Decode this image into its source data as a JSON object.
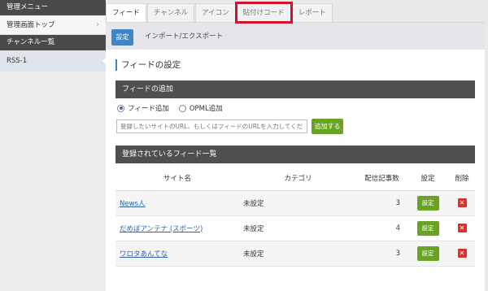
{
  "sidebar": {
    "menu_title": "管理メニュー",
    "admin_top": "管理画面トップ",
    "channel_title": "チャンネル一覧",
    "channels": [
      "RSS-1"
    ]
  },
  "tabs": [
    {
      "label": "フィード"
    },
    {
      "label": "チャンネル"
    },
    {
      "label": "アイコン"
    },
    {
      "label": "貼付けコード"
    },
    {
      "label": "レポート"
    }
  ],
  "toolbar": {
    "setting_button": "設定",
    "import_link": "インポート/エクスポート"
  },
  "page": {
    "section_title": "フィードの設定",
    "add_bar": "フィードの追加",
    "radio_feed": "フィード追加",
    "radio_opml": "OPML追加",
    "url_placeholder": "登録したいサイトのURL、もしくはフィードのURLを入力してくだ",
    "register_button": "追加する",
    "list_bar": "登録されているフィード一覧"
  },
  "table": {
    "headers": [
      "サイト名",
      "カテゴリ",
      "配信記事数",
      "設定",
      "削除"
    ],
    "rows": [
      {
        "name": "News人",
        "category": "未設定",
        "count": "3",
        "edit": "設定"
      },
      {
        "name": "だめぽアンテナ (スポーツ)",
        "category": "未設定",
        "count": "4",
        "edit": "設定"
      },
      {
        "name": "ワロタあんてな",
        "category": "未設定",
        "count": "3",
        "edit": "設定"
      }
    ],
    "delete_glyph": "✕"
  }
}
